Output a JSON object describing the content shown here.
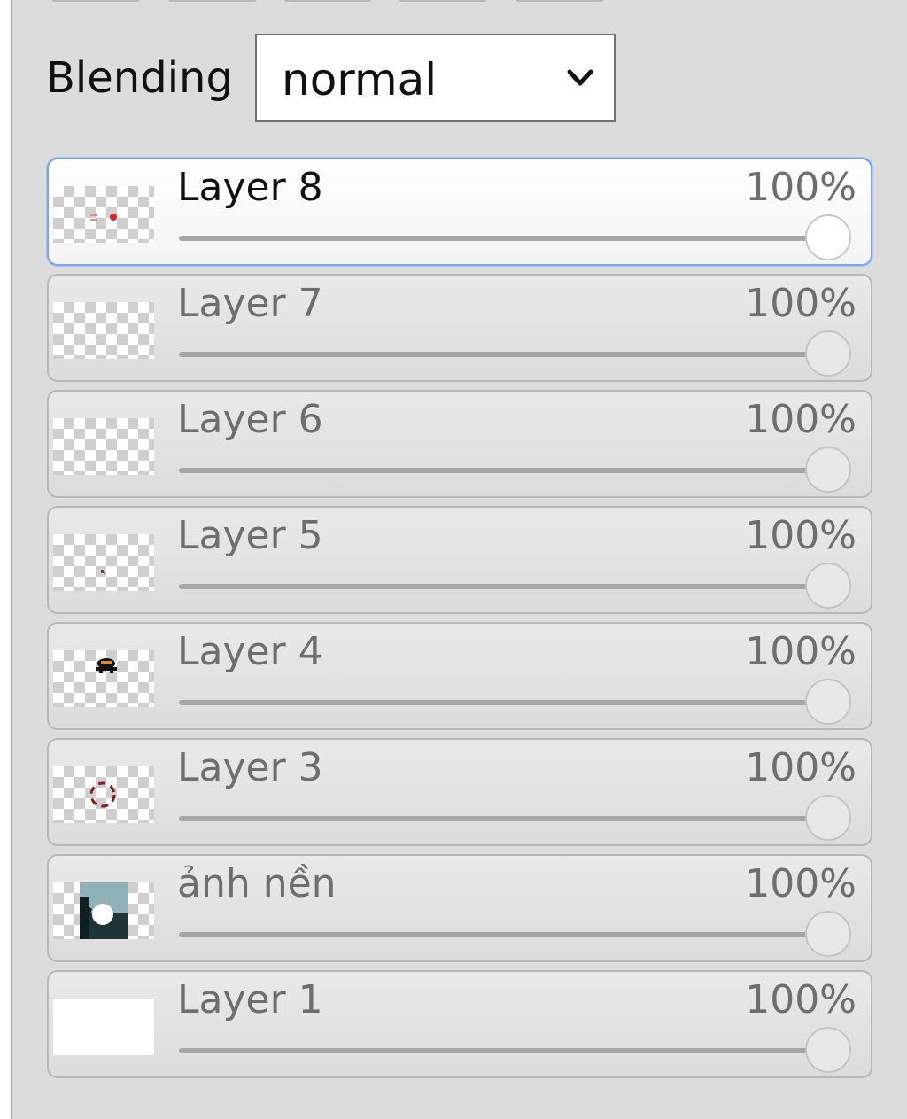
{
  "blending": {
    "label": "Blending",
    "value": "normal"
  },
  "layers": [
    {
      "name": "Layer 8",
      "opacity_label": "100%",
      "opacity": 1.0,
      "selected": true,
      "thumb": "red-dots"
    },
    {
      "name": "Layer 7",
      "opacity_label": "100%",
      "opacity": 1.0,
      "selected": false,
      "thumb": "empty"
    },
    {
      "name": "Layer 6",
      "opacity_label": "100%",
      "opacity": 1.0,
      "selected": false,
      "thumb": "empty"
    },
    {
      "name": "Layer 5",
      "opacity_label": "100%",
      "opacity": 1.0,
      "selected": false,
      "thumb": "small-mark"
    },
    {
      "name": "Layer 4",
      "opacity_label": "100%",
      "opacity": 1.0,
      "selected": false,
      "thumb": "dark-figure"
    },
    {
      "name": "Layer 3",
      "opacity_label": "100%",
      "opacity": 1.0,
      "selected": false,
      "thumb": "red-circle"
    },
    {
      "name": "ảnh nền",
      "opacity_label": "100%",
      "opacity": 1.0,
      "selected": false,
      "thumb": "background-photo"
    },
    {
      "name": "Layer 1",
      "opacity_label": "100%",
      "opacity": 1.0,
      "selected": false,
      "thumb": "white"
    }
  ]
}
